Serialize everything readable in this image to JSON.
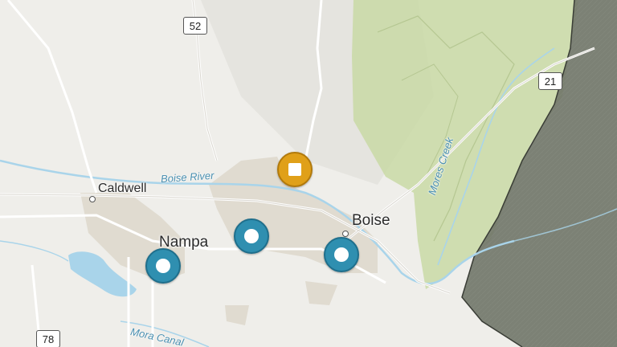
{
  "map": {
    "cities": [
      {
        "name": "Caldwell",
        "size": "small"
      },
      {
        "name": "Nampa",
        "size": "large"
      },
      {
        "name": "Boise",
        "size": "large"
      }
    ],
    "water_labels": [
      "Boise River",
      "Mores Creek",
      "Mora Canal"
    ],
    "route_shields": [
      "52",
      "21",
      "78"
    ],
    "markers": [
      {
        "type": "site",
        "color": "#2f8fb0"
      },
      {
        "type": "site",
        "color": "#2f8fb0"
      },
      {
        "type": "site",
        "color": "#2f8fb0"
      },
      {
        "type": "special",
        "color": "#e0a019"
      }
    ],
    "colors": {
      "background": "#efeeea",
      "forest": "#c9d9a6",
      "shaded_region": "#6f7468",
      "water": "#a9d4ea",
      "urban": "#e0dbd0"
    }
  }
}
